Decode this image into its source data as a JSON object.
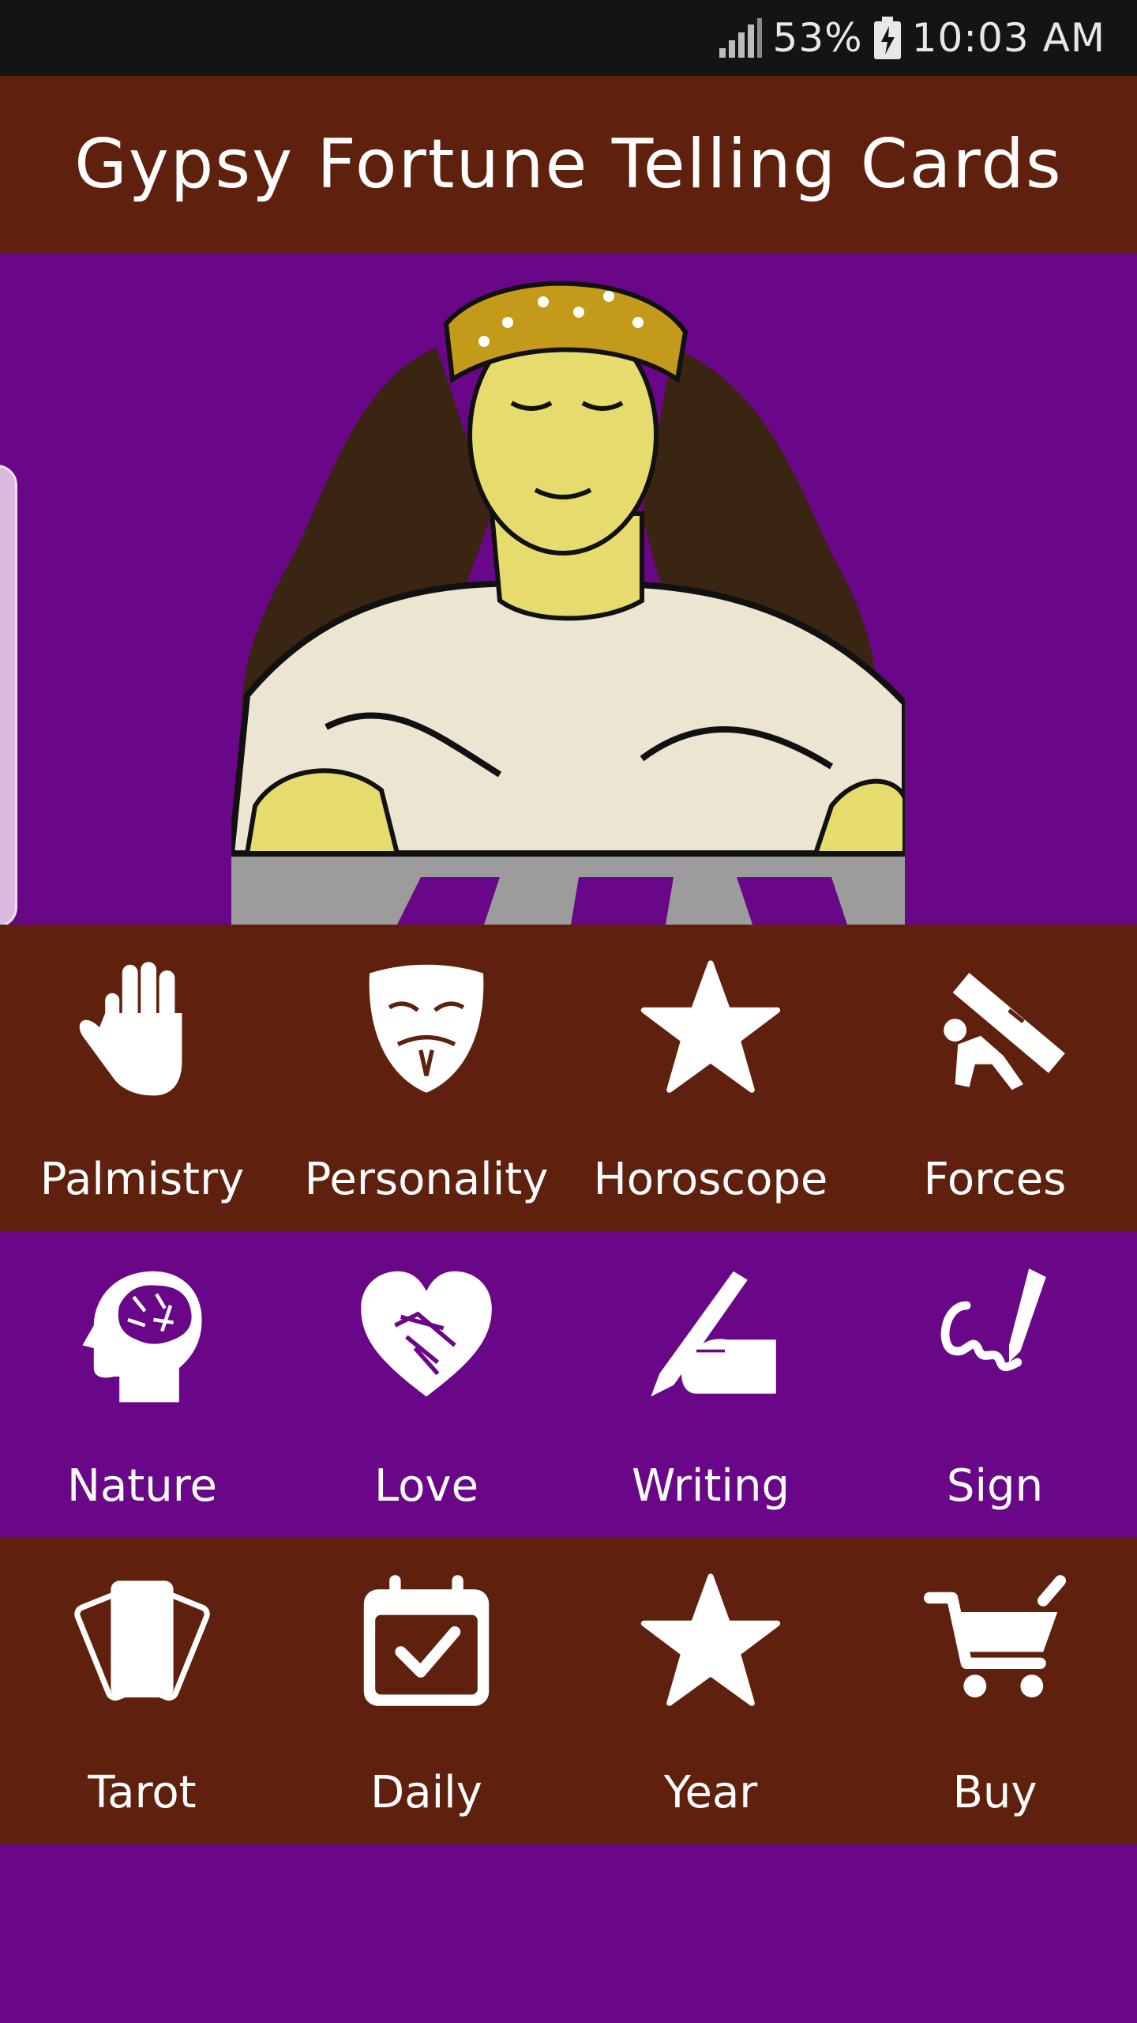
{
  "status": {
    "battery": "53%",
    "time": "10:03 AM"
  },
  "header": {
    "title": "Gypsy Fortune Telling Cards"
  },
  "menu": {
    "rows": [
      [
        {
          "label": "Palmistry",
          "icon": "hand-icon"
        },
        {
          "label": "Personality",
          "icon": "mask-icon"
        },
        {
          "label": "Horoscope",
          "icon": "star-icon"
        },
        {
          "label": "Forces",
          "icon": "forces-icon"
        }
      ],
      [
        {
          "label": "Nature",
          "icon": "brain-head-icon"
        },
        {
          "label": "Love",
          "icon": "heart-handshake-icon"
        },
        {
          "label": "Writing",
          "icon": "writing-hand-icon"
        },
        {
          "label": "Sign",
          "icon": "signature-pen-icon"
        }
      ],
      [
        {
          "label": "Tarot",
          "icon": "cards-icon"
        },
        {
          "label": "Daily",
          "icon": "calendar-check-icon"
        },
        {
          "label": "Year",
          "icon": "star-icon"
        },
        {
          "label": "Buy",
          "icon": "cart-icon"
        }
      ]
    ]
  },
  "colors": {
    "brown": "#5f200e",
    "purple": "#6a0788",
    "statusbar": "#141416"
  }
}
